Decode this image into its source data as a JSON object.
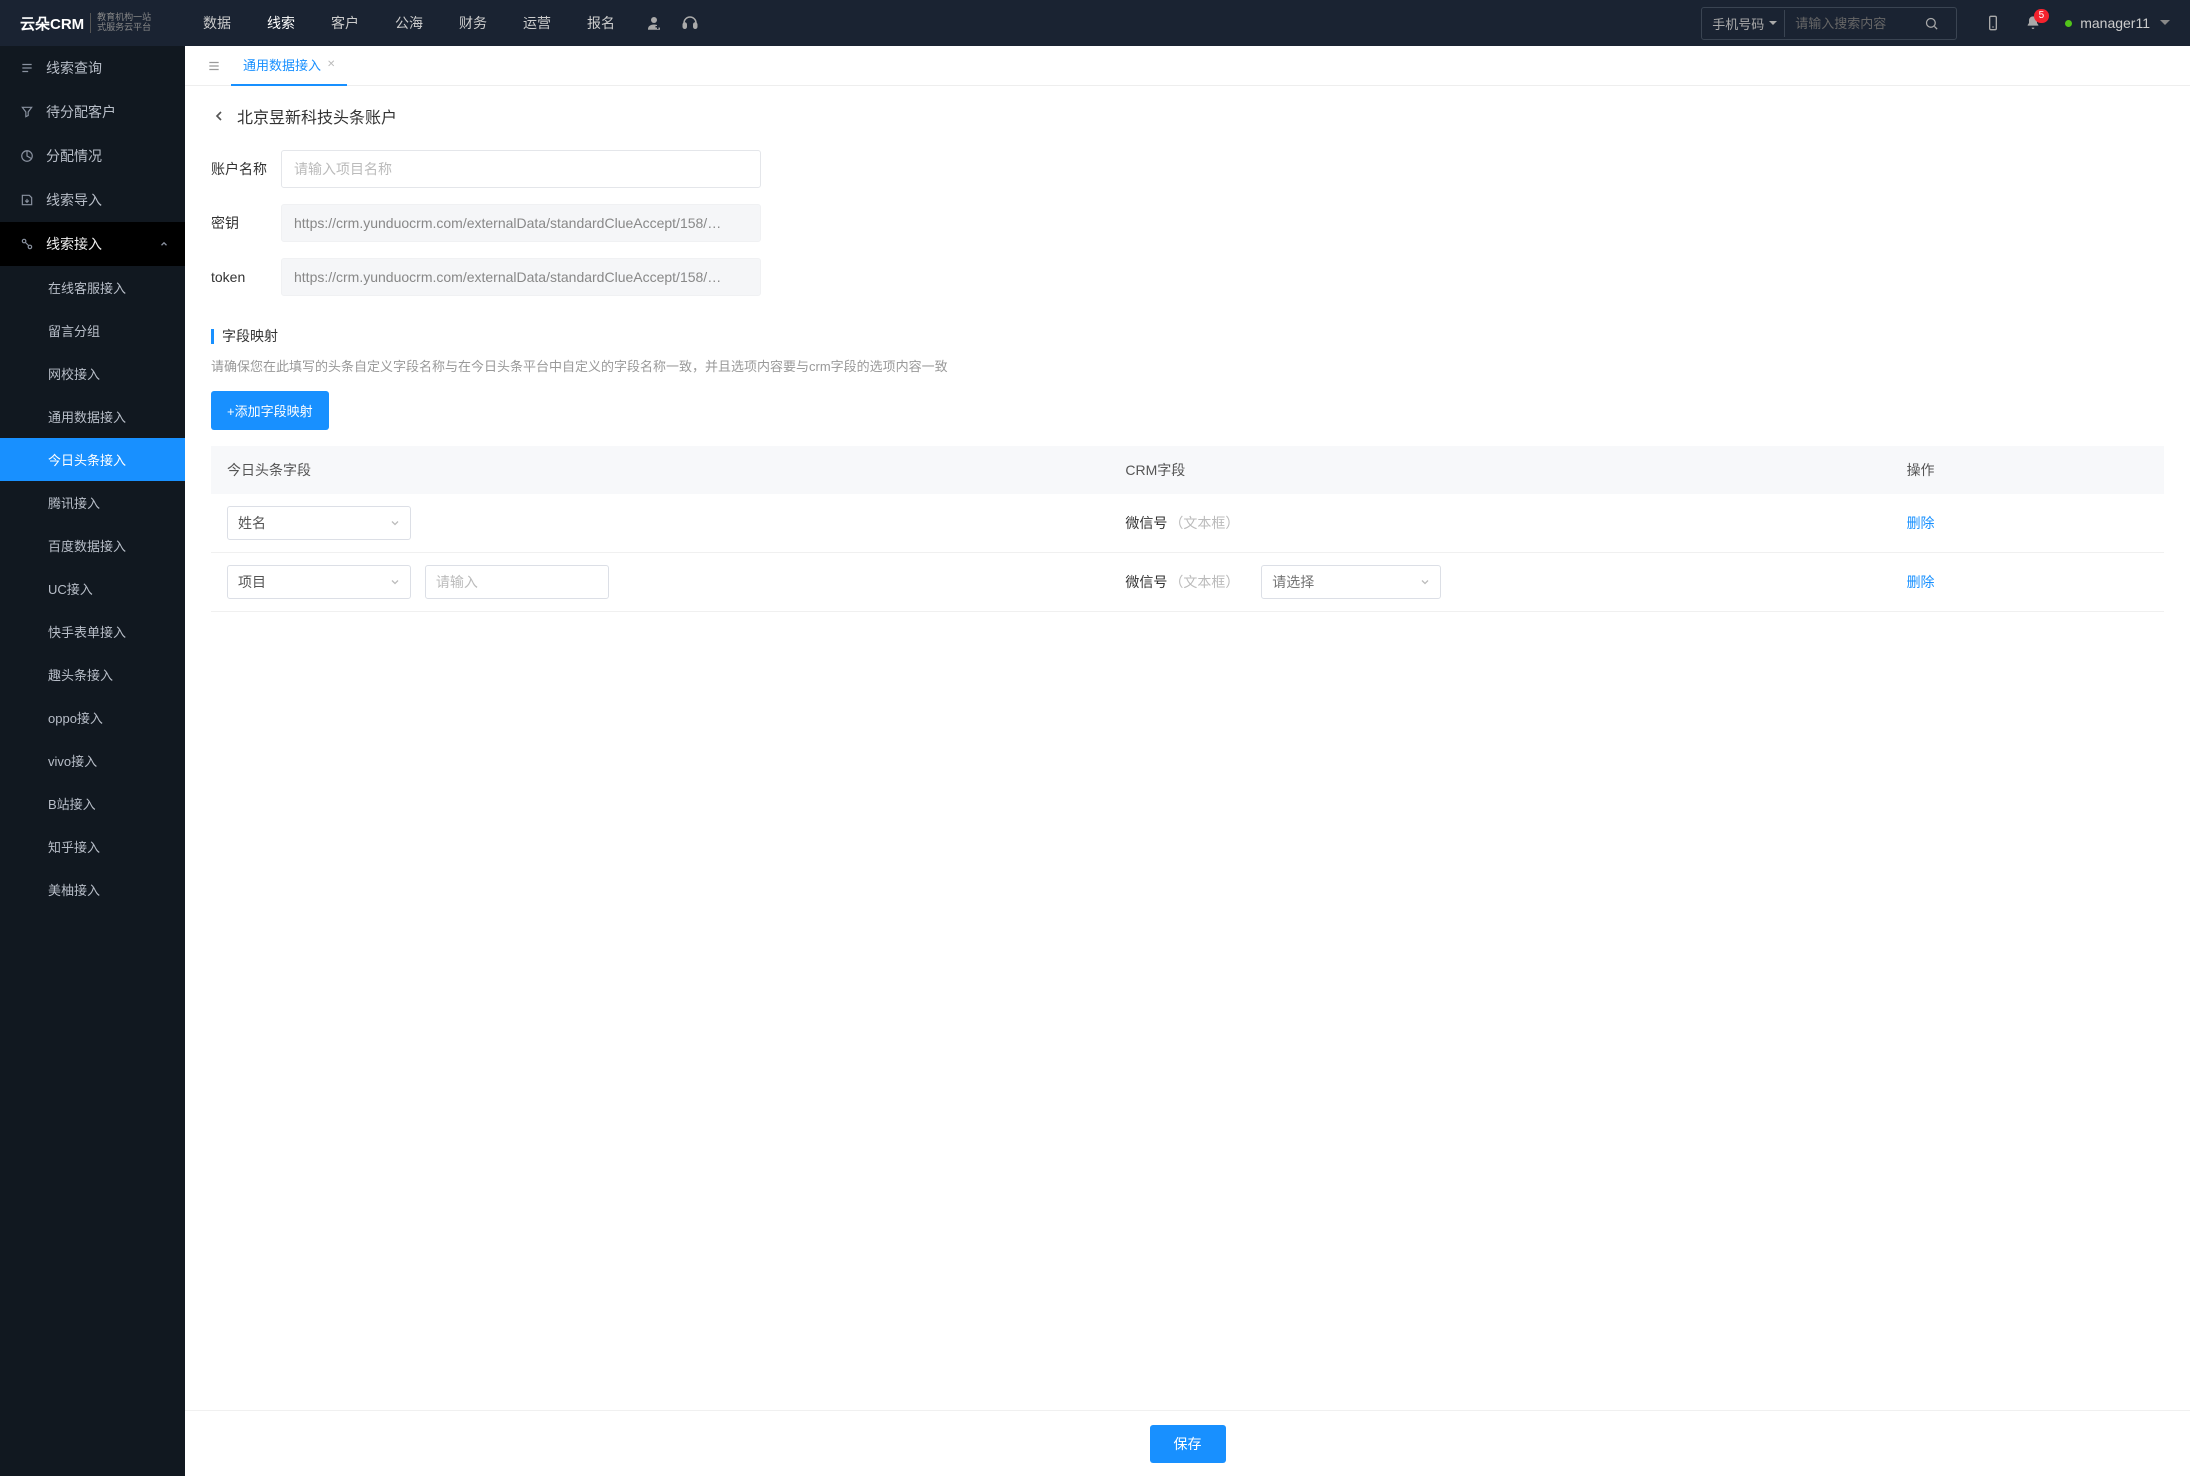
{
  "header": {
    "logo_brand": "云朵CRM",
    "logo_sub1": "教育机构一站",
    "logo_sub2": "式服务云平台",
    "nav": [
      "数据",
      "线索",
      "客户",
      "公海",
      "财务",
      "运营",
      "报名"
    ],
    "nav_active_index": 1,
    "search_type": "手机号码",
    "search_placeholder": "请输入搜索内容",
    "notification_count": "5",
    "username": "manager11"
  },
  "sidebar": {
    "items": [
      {
        "label": "线索查询"
      },
      {
        "label": "待分配客户"
      },
      {
        "label": "分配情况"
      },
      {
        "label": "线索导入"
      },
      {
        "label": "线索接入"
      }
    ],
    "sub_items": [
      {
        "label": "在线客服接入"
      },
      {
        "label": "留言分组"
      },
      {
        "label": "网校接入"
      },
      {
        "label": "通用数据接入"
      },
      {
        "label": "今日头条接入"
      },
      {
        "label": "腾讯接入"
      },
      {
        "label": "百度数据接入"
      },
      {
        "label": "UC接入"
      },
      {
        "label": "快手表单接入"
      },
      {
        "label": "趣头条接入"
      },
      {
        "label": "oppo接入"
      },
      {
        "label": "vivo接入"
      },
      {
        "label": "B站接入"
      },
      {
        "label": "知乎接入"
      },
      {
        "label": "美柚接入"
      }
    ],
    "sub_active_index": 4
  },
  "tabs": {
    "items": [
      {
        "label": "通用数据接入"
      }
    ],
    "active_index": 0
  },
  "page": {
    "title": "北京昱新科技头条账户",
    "form": {
      "account_label": "账户名称",
      "account_placeholder": "请输入项目名称",
      "account_value": "",
      "secret_label": "密钥",
      "secret_value": "https://crm.yunduocrm.com/externalData/standardClueAccept/158/…",
      "token_label": "token",
      "token_value": "https://crm.yunduocrm.com/externalData/standardClueAccept/158/…"
    },
    "mapping": {
      "section_title": "字段映射",
      "hint": "请确保您在此填写的头条自定义字段名称与在今日头条平台中自定义的字段名称一致，并且选项内容要与crm字段的选项内容一致",
      "add_button": "+添加字段映射",
      "columns": {
        "c1": "今日头条字段",
        "c2": "CRM字段",
        "c3": "操作"
      },
      "rows": [
        {
          "toutiao_field": "姓名",
          "extra_input_placeholder": "",
          "crm_field_name": "微信号",
          "crm_field_type": "（文本框）",
          "crm_select_placeholder": "",
          "op": "删除",
          "show_extra": false,
          "show_crm_select": false
        },
        {
          "toutiao_field": "项目",
          "extra_input_placeholder": "请输入",
          "crm_field_name": "微信号",
          "crm_field_type": "（文本框）",
          "crm_select_placeholder": "请选择",
          "op": "删除",
          "show_extra": true,
          "show_crm_select": true
        }
      ]
    },
    "save_button": "保存"
  }
}
